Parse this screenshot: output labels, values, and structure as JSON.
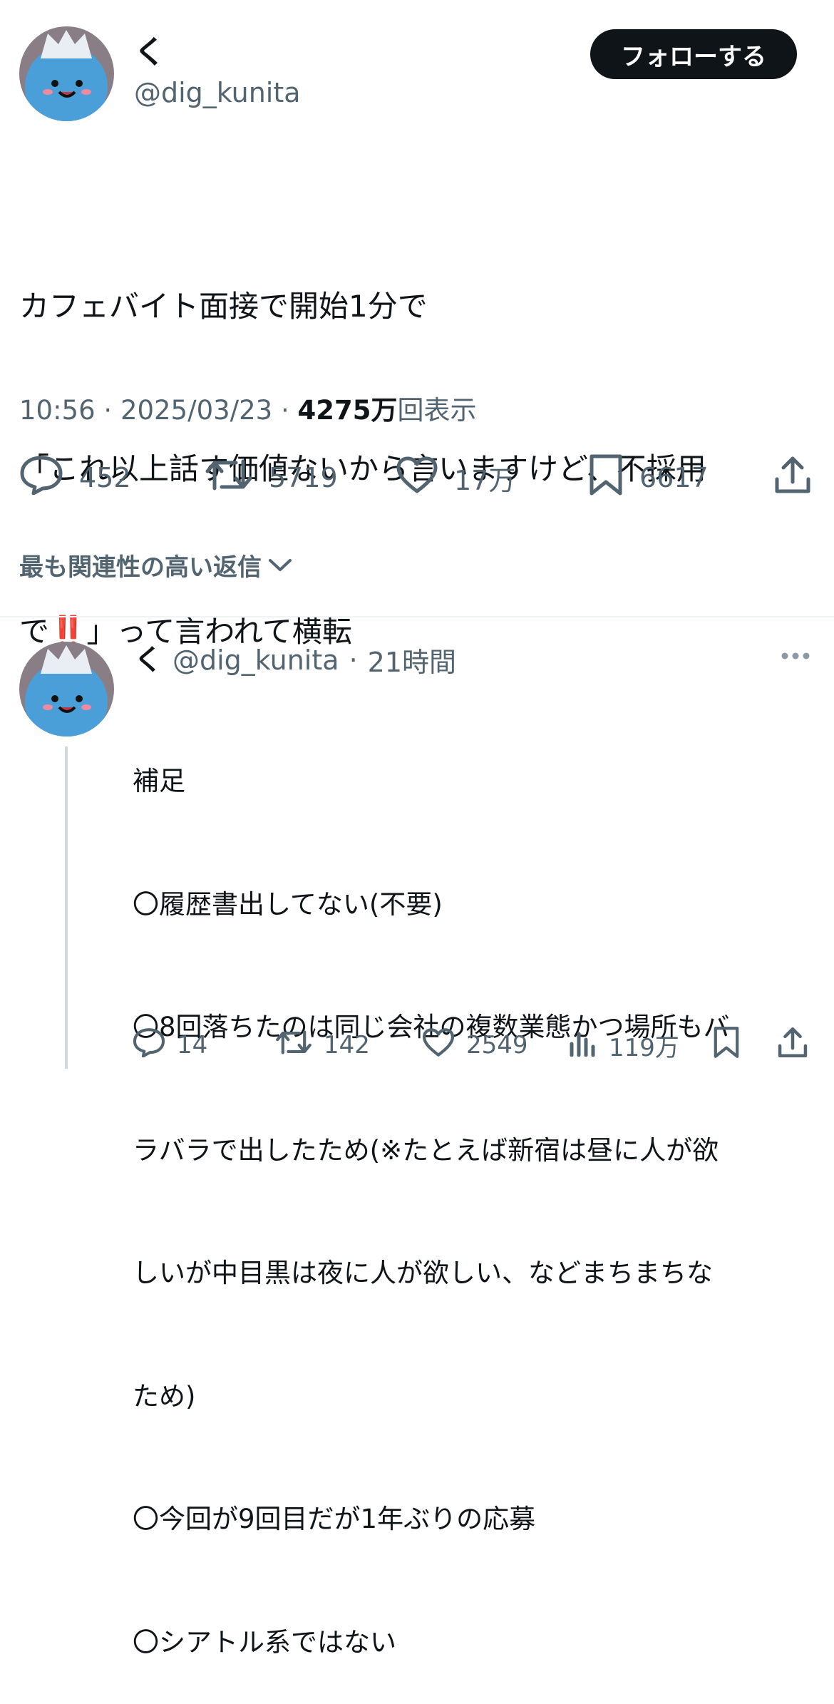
{
  "tweet": {
    "author_name": "く",
    "handle": "@dig_kunita",
    "follow_label": "フォローする",
    "text_line1": "カフェバイト面接で開始1分で",
    "text_line2": "「これ以上話す価値ないから言いますけど、不採用",
    "text_line3_pre": "で",
    "text_line3_emoji": "‼️",
    "text_line3_post": "」って言われて横転",
    "time": "10:56",
    "date": "2025/03/23",
    "views_count": "4275万",
    "views_label": "回表示",
    "replies": "452",
    "retweets": "5719",
    "likes": "17万",
    "bookmarks": "6617"
  },
  "sort_label": "最も関連性の高い返信",
  "reply": {
    "author_name": "く",
    "handle": "@dig_kunita",
    "time_ago": "21時間",
    "lines": [
      "補足",
      "〇履歴書出してない(不要)",
      "〇8回落ちたのは同じ会社の複数業態かつ場所もバ",
      "ラバラで出したため(※たとえば新宿は昼に人が欲",
      "しいが中目黒は夜に人が欲しい、などまちまちな",
      "ため)",
      "〇今回が9回目だが1年ぶりの応募",
      "〇シアトル系ではない"
    ],
    "replies": "14",
    "retweets": "142",
    "likes": "2549",
    "views": "119万"
  },
  "colors": {
    "text": "#0f1419",
    "muted": "#536471",
    "divider": "#eff3f4",
    "emoji_red": "#e0245e",
    "avatar_blue": "#4a9fd8"
  }
}
